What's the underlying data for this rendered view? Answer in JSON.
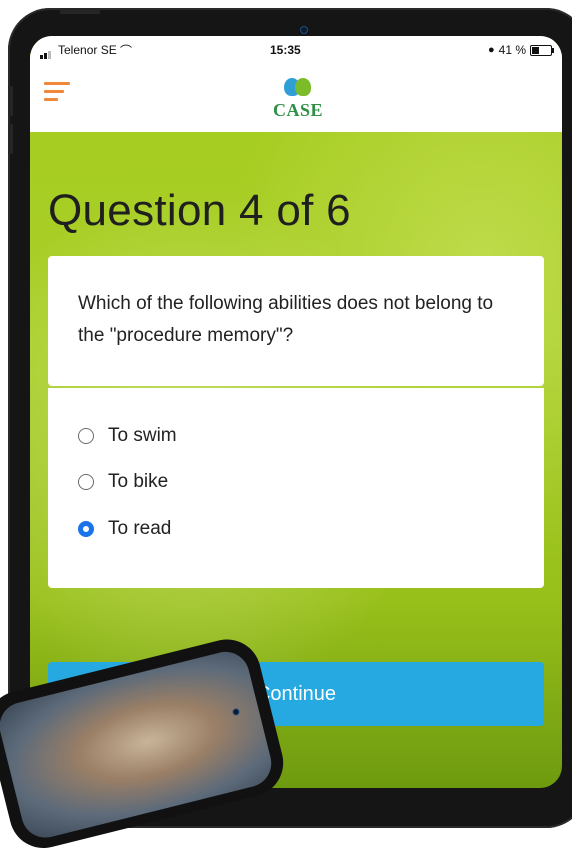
{
  "status_bar": {
    "carrier": "Telenor SE",
    "time": "15:35",
    "battery": "41 %",
    "battery_level": 0.41
  },
  "app": {
    "logo_text": "CASE"
  },
  "quiz": {
    "title": "Question 4 of 6",
    "question": "Which of the following abilities does not belong to the \"procedure memory\"?",
    "options": [
      {
        "label": "To swim",
        "selected": false
      },
      {
        "label": "To bike",
        "selected": false
      },
      {
        "label": "To read",
        "selected": true
      }
    ],
    "continue_label": "Continue"
  },
  "colors": {
    "accent": "#26a9e0",
    "radio_selected": "#1a73e8",
    "background_green": "#a5cc1c",
    "menu_icon": "#f0883a"
  }
}
